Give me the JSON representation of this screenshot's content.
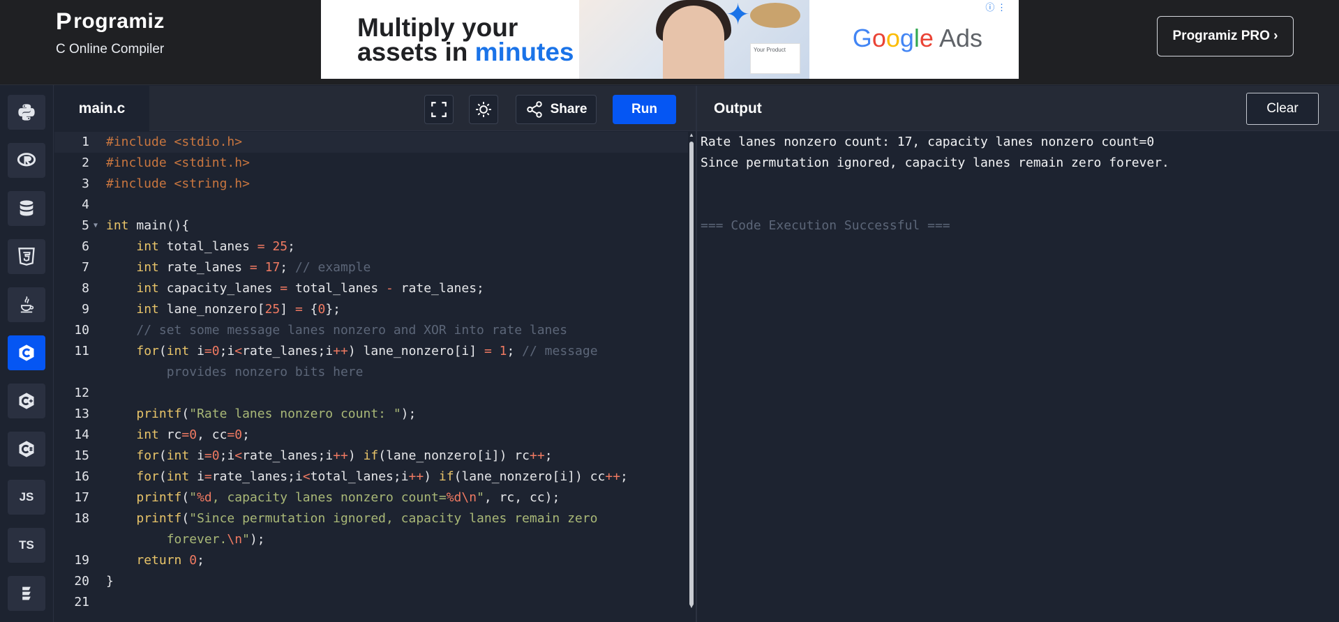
{
  "header": {
    "logo_text": "rogramiz",
    "logo_initial": "P",
    "subtitle": "C Online Compiler",
    "pro_button": "Programiz PRO ›"
  },
  "ad": {
    "line1": "Multiply your",
    "line2a": "assets in ",
    "line2b": "minutes",
    "brand_g": "G",
    "brand_o1": "o",
    "brand_o2": "o",
    "brand_g2": "g",
    "brand_l": "l",
    "brand_e": "e",
    "brand_ads": " Ads",
    "card_text": "Your Product",
    "info": "ⓘ ⋮"
  },
  "sidebar": {
    "items": [
      {
        "name": "python",
        "label": ""
      },
      {
        "name": "r",
        "label": ""
      },
      {
        "name": "sql",
        "label": ""
      },
      {
        "name": "html",
        "label": ""
      },
      {
        "name": "java",
        "label": ""
      },
      {
        "name": "c",
        "label": ""
      },
      {
        "name": "cpp",
        "label": ""
      },
      {
        "name": "csharp",
        "label": ""
      },
      {
        "name": "js",
        "label": "JS"
      },
      {
        "name": "ts",
        "label": "TS"
      },
      {
        "name": "go",
        "label": ""
      }
    ],
    "active": "c"
  },
  "editor": {
    "tab": "main.c",
    "share_label": "Share",
    "run_label": "Run",
    "line_numbers": [
      "1",
      "2",
      "3",
      "4",
      "5",
      "6",
      "7",
      "8",
      "9",
      "10",
      "11",
      "",
      "12",
      "13",
      "14",
      "15",
      "16",
      "17",
      "18",
      "",
      "19",
      "20",
      "21"
    ]
  },
  "output": {
    "title": "Output",
    "clear_label": "Clear",
    "lines": [
      "Rate lanes nonzero count: 17, capacity lanes nonzero count=0",
      "Since permutation ignored, capacity lanes remain zero forever."
    ],
    "status": "=== Code Execution Successful ==="
  },
  "colors": {
    "accent": "#0556f3",
    "keyword": "#e8c469",
    "number": "#f07a62",
    "string": "#a9b877",
    "comment": "#5c6678"
  }
}
